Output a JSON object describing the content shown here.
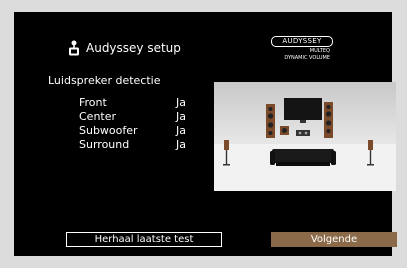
{
  "header": {
    "title": "Audyssey setup",
    "icon": "microphone-icon",
    "logo": {
      "brand": "AUDYSSEY",
      "line1": "MULTEQ",
      "line2": "DYNAMIC VOLUME"
    }
  },
  "section": {
    "title": "Luidspreker detectie"
  },
  "speakers": [
    {
      "name": "Front",
      "value": "Ja"
    },
    {
      "name": "Center",
      "value": "Ja"
    },
    {
      "name": "Subwoofer",
      "value": "Ja"
    },
    {
      "name": "Surround",
      "value": "Ja"
    }
  ],
  "room_illustration": {
    "icon": "speaker-layout-illustration",
    "colors": {
      "wood": "#7a4a2a",
      "tv": "#1a1a1a",
      "wall": "#c8c8c8"
    }
  },
  "buttons": {
    "repeat_label": "Herhaal laatste test",
    "next_label": "Volgende"
  },
  "colors": {
    "background": "#000000",
    "text": "#ffffff",
    "accent": "#8a6a48",
    "frame": "#dcdcdc"
  }
}
